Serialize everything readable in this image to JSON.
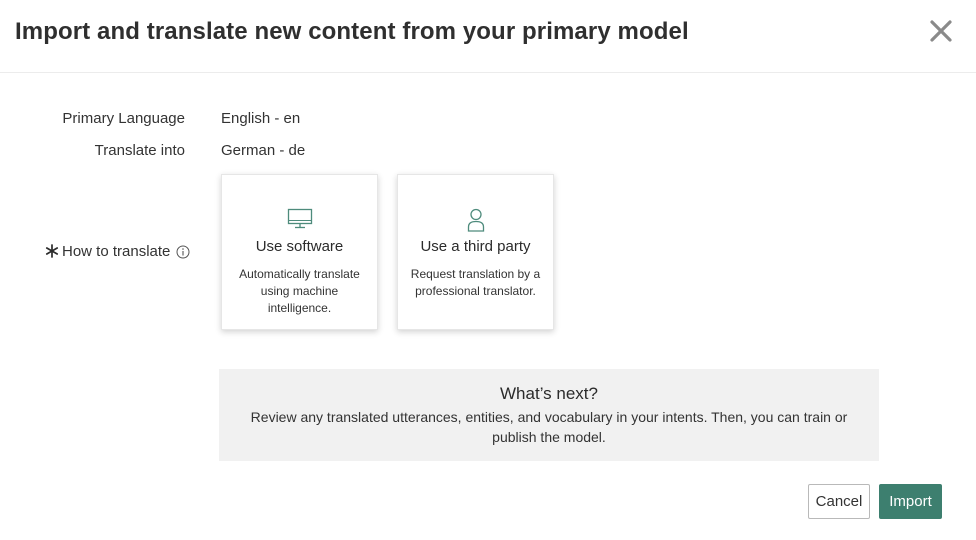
{
  "dialog": {
    "title": "Import and translate new content from your primary model",
    "close_icon": "close-icon"
  },
  "form": {
    "primary_language_label": "Primary Language",
    "primary_language_value": "English - en",
    "translate_into_label": "Translate into",
    "translate_into_value": "German - de",
    "how_label": "How to translate",
    "required_icon": "asterisk-icon",
    "info_icon": "info-icon"
  },
  "options": [
    {
      "icon": "monitor-icon",
      "title": "Use software",
      "description": "Automatically translate using machine intelligence."
    },
    {
      "icon": "person-icon",
      "title": "Use a third party",
      "description": "Request translation by a professional translator."
    }
  ],
  "next": {
    "title": "What’s next?",
    "body": "Review any translated utterances, entities, and vocabulary in your intents. Then, you can train or publish the model."
  },
  "footer": {
    "cancel_label": "Cancel",
    "import_label": "Import"
  },
  "colors": {
    "accent": "#3d7f6f",
    "panel_bg": "#f1f1f1",
    "icon_green": "#4e8b7c"
  }
}
